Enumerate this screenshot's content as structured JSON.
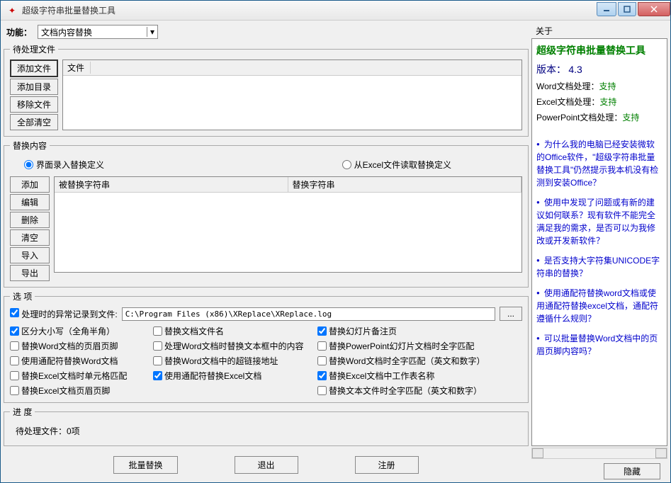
{
  "window": {
    "title": "超级字符串批量替换工具"
  },
  "toolbar": {
    "label": "功能：",
    "combo_value": "文档内容替换"
  },
  "files": {
    "legend": "待处理文件",
    "buttons": {
      "add_file": "添加文件",
      "add_dir": "添加目录",
      "remove": "移除文件",
      "clear": "全部清空"
    },
    "header": "文件"
  },
  "replace": {
    "legend": "替换内容",
    "radio_interface": "界面录入替换定义",
    "radio_excel": "从Excel文件读取替换定义",
    "buttons": {
      "add": "添加",
      "edit": "编辑",
      "delete": "删除",
      "clear": "清空",
      "import": "导入",
      "export": "导出"
    },
    "col1": "被替换字符串",
    "col2": "替换字符串"
  },
  "options": {
    "legend": "选  项",
    "log_label": "处理时的异常记录到文件:",
    "log_path": "C:\\Program Files (x86)\\XReplace\\XReplace.log",
    "browse": "...",
    "items": {
      "case_sensitive": "区分大小写（全角半角）",
      "replace_filename": "替换文档文件名",
      "replace_ppt_notes": "替换幻灯片备注页",
      "replace_word_header": "替换Word文档的页眉页脚",
      "word_textbox": "处理Word文档时替换文本框中的内容",
      "ppt_whole": "替换PowerPoint幻灯片文档时全字匹配",
      "wildcard_word": "使用通配符替换Word文档",
      "word_hyperlink": "替换Word文档中的超链接地址",
      "word_whole": "替换Word文档时全字匹配（英文和数字）",
      "excel_cell": "替换Excel文档时单元格匹配",
      "wildcard_excel": "使用通配符替换Excel文档",
      "excel_sheet": "替换Excel文档中工作表名称",
      "excel_header": "替换Excel文档页眉页脚",
      "text_whole": "替换文本文件时全字匹配（英文和数字）"
    }
  },
  "progress": {
    "legend": "进  度",
    "text": "待处理文件：0项"
  },
  "bottom": {
    "batch": "批量替换",
    "exit": "退出",
    "register": "注册"
  },
  "about": {
    "header": "关于",
    "title": "超级字符串批量替换工具",
    "version_label": "版本：",
    "version": "4.3",
    "word": "Word文档处理：",
    "excel": "Excel文档处理：",
    "ppt": "PowerPoint文档处理：",
    "support": "支持",
    "faq1": "为什么我的电脑已经安装微软的Office软件，\"超级字符串批量替换工具\"仍然提示我本机没有检测到安装Office？",
    "faq2": "使用中发现了问题或有新的建议如何联系？现有软件不能完全满足我的需求，是否可以为我修改或开发新软件？",
    "faq3": "是否支持大字符集UNICODE字符串的替换？",
    "faq4": "使用通配符替换word文档或使用通配符替换excel文档，通配符遵循什么规则？",
    "faq5": "可以批量替换Word文档中的页眉页脚内容吗？",
    "hide": "隐藏"
  }
}
